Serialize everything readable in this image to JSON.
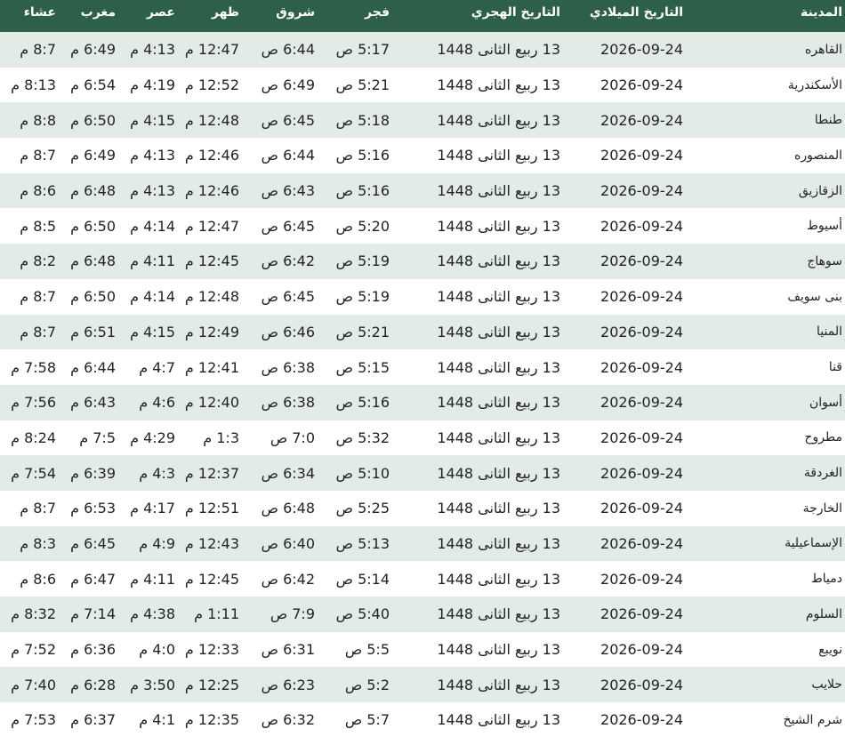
{
  "header": {
    "city": "المدينة",
    "gregorian": "التاريخ الميلادي",
    "hijri": "التاريخ الهجري",
    "fajr": "فجر",
    "shuruq": "شروق",
    "dhuhr": "ظهر",
    "asr": "عصر",
    "maghrib": "مغرب",
    "isha": "عشاء"
  },
  "rows": [
    {
      "city": "القاهره",
      "gregorian": "2026-09-24",
      "hijri": "13 ربيع الثانى 1448",
      "fajr": "5:17 ص",
      "shuruq": "6:44 ص",
      "dhuhr": "12:47 م",
      "asr": "4:13 م",
      "maghrib": "6:49 م",
      "isha": "8:7 م"
    },
    {
      "city": "الأسكندرية",
      "gregorian": "2026-09-24",
      "hijri": "13 ربيع الثانى 1448",
      "fajr": "5:21 ص",
      "shuruq": "6:49 ص",
      "dhuhr": "12:52 م",
      "asr": "4:19 م",
      "maghrib": "6:54 م",
      "isha": "8:13 م"
    },
    {
      "city": "طنطا",
      "gregorian": "2026-09-24",
      "hijri": "13 ربيع الثانى 1448",
      "fajr": "5:18 ص",
      "shuruq": "6:45 ص",
      "dhuhr": "12:48 م",
      "asr": "4:15 م",
      "maghrib": "6:50 م",
      "isha": "8:8 م"
    },
    {
      "city": "المنصوره",
      "gregorian": "2026-09-24",
      "hijri": "13 ربيع الثانى 1448",
      "fajr": "5:16 ص",
      "shuruq": "6:44 ص",
      "dhuhr": "12:46 م",
      "asr": "4:13 م",
      "maghrib": "6:49 م",
      "isha": "8:7 م"
    },
    {
      "city": "الزقازيق",
      "gregorian": "2026-09-24",
      "hijri": "13 ربيع الثانى 1448",
      "fajr": "5:16 ص",
      "shuruq": "6:43 ص",
      "dhuhr": "12:46 م",
      "asr": "4:13 م",
      "maghrib": "6:48 م",
      "isha": "8:6 م"
    },
    {
      "city": "أسيوط",
      "gregorian": "2026-09-24",
      "hijri": "13 ربيع الثانى 1448",
      "fajr": "5:20 ص",
      "shuruq": "6:45 ص",
      "dhuhr": "12:47 م",
      "asr": "4:14 م",
      "maghrib": "6:50 م",
      "isha": "8:5 م"
    },
    {
      "city": "سوهاج",
      "gregorian": "2026-09-24",
      "hijri": "13 ربيع الثانى 1448",
      "fajr": "5:19 ص",
      "shuruq": "6:42 ص",
      "dhuhr": "12:45 م",
      "asr": "4:11 م",
      "maghrib": "6:48 م",
      "isha": "8:2 م"
    },
    {
      "city": "بنى سويف",
      "gregorian": "2026-09-24",
      "hijri": "13 ربيع الثانى 1448",
      "fajr": "5:19 ص",
      "shuruq": "6:45 ص",
      "dhuhr": "12:48 م",
      "asr": "4:14 م",
      "maghrib": "6:50 م",
      "isha": "8:7 م"
    },
    {
      "city": "المنيا",
      "gregorian": "2026-09-24",
      "hijri": "13 ربيع الثانى 1448",
      "fajr": "5:21 ص",
      "shuruq": "6:46 ص",
      "dhuhr": "12:49 م",
      "asr": "4:15 م",
      "maghrib": "6:51 م",
      "isha": "8:7 م"
    },
    {
      "city": "قنا",
      "gregorian": "2026-09-24",
      "hijri": "13 ربيع الثانى 1448",
      "fajr": "5:15 ص",
      "shuruq": "6:38 ص",
      "dhuhr": "12:41 م",
      "asr": "4:7 م",
      "maghrib": "6:44 م",
      "isha": "7:58 م"
    },
    {
      "city": "أسوان",
      "gregorian": "2026-09-24",
      "hijri": "13 ربيع الثانى 1448",
      "fajr": "5:16 ص",
      "shuruq": "6:38 ص",
      "dhuhr": "12:40 م",
      "asr": "4:6 م",
      "maghrib": "6:43 م",
      "isha": "7:56 م"
    },
    {
      "city": "مطروح",
      "gregorian": "2026-09-24",
      "hijri": "13 ربيع الثانى 1448",
      "fajr": "5:32 ص",
      "shuruq": "7:0 ص",
      "dhuhr": "1:3 م",
      "asr": "4:29 م",
      "maghrib": "7:5 م",
      "isha": "8:24 م"
    },
    {
      "city": "الغردقة",
      "gregorian": "2026-09-24",
      "hijri": "13 ربيع الثانى 1448",
      "fajr": "5:10 ص",
      "shuruq": "6:34 ص",
      "dhuhr": "12:37 م",
      "asr": "4:3 م",
      "maghrib": "6:39 م",
      "isha": "7:54 م"
    },
    {
      "city": "الخارجة",
      "gregorian": "2026-09-24",
      "hijri": "13 ربيع الثانى 1448",
      "fajr": "5:25 ص",
      "shuruq": "6:48 ص",
      "dhuhr": "12:51 م",
      "asr": "4:17 م",
      "maghrib": "6:53 م",
      "isha": "8:7 م"
    },
    {
      "city": "الإسماعيلية",
      "gregorian": "2026-09-24",
      "hijri": "13 ربيع الثانى 1448",
      "fajr": "5:13 ص",
      "shuruq": "6:40 ص",
      "dhuhr": "12:43 م",
      "asr": "4:9 م",
      "maghrib": "6:45 م",
      "isha": "8:3 م"
    },
    {
      "city": "دمياط",
      "gregorian": "2026-09-24",
      "hijri": "13 ربيع الثانى 1448",
      "fajr": "5:14 ص",
      "shuruq": "6:42 ص",
      "dhuhr": "12:45 م",
      "asr": "4:11 م",
      "maghrib": "6:47 م",
      "isha": "8:6 م"
    },
    {
      "city": "السلوم",
      "gregorian": "2026-09-24",
      "hijri": "13 ربيع الثانى 1448",
      "fajr": "5:40 ص",
      "shuruq": "7:9 ص",
      "dhuhr": "1:11 م",
      "asr": "4:38 م",
      "maghrib": "7:14 م",
      "isha": "8:32 م"
    },
    {
      "city": "نويبع",
      "gregorian": "2026-09-24",
      "hijri": "13 ربيع الثانى 1448",
      "fajr": "5:5 ص",
      "shuruq": "6:31 ص",
      "dhuhr": "12:33 م",
      "asr": "4:0 م",
      "maghrib": "6:36 م",
      "isha": "7:52 م"
    },
    {
      "city": "حلايب",
      "gregorian": "2026-09-24",
      "hijri": "13 ربيع الثانى 1448",
      "fajr": "5:2 ص",
      "shuruq": "6:23 ص",
      "dhuhr": "12:25 م",
      "asr": "3:50 م",
      "maghrib": "6:28 م",
      "isha": "7:40 م"
    },
    {
      "city": "شرم الشيخ",
      "gregorian": "2026-09-24",
      "hijri": "13 ربيع الثانى 1448",
      "fajr": "5:7 ص",
      "shuruq": "6:32 ص",
      "dhuhr": "12:35 م",
      "asr": "4:1 م",
      "maghrib": "6:37 م",
      "isha": "7:53 م"
    }
  ],
  "colors": {
    "header_bg": "#2d5f4a",
    "header_text": "#ffffff",
    "row_alt_bg": "#e3ebe7",
    "row_bg": "#ffffff",
    "text": "#232323"
  }
}
